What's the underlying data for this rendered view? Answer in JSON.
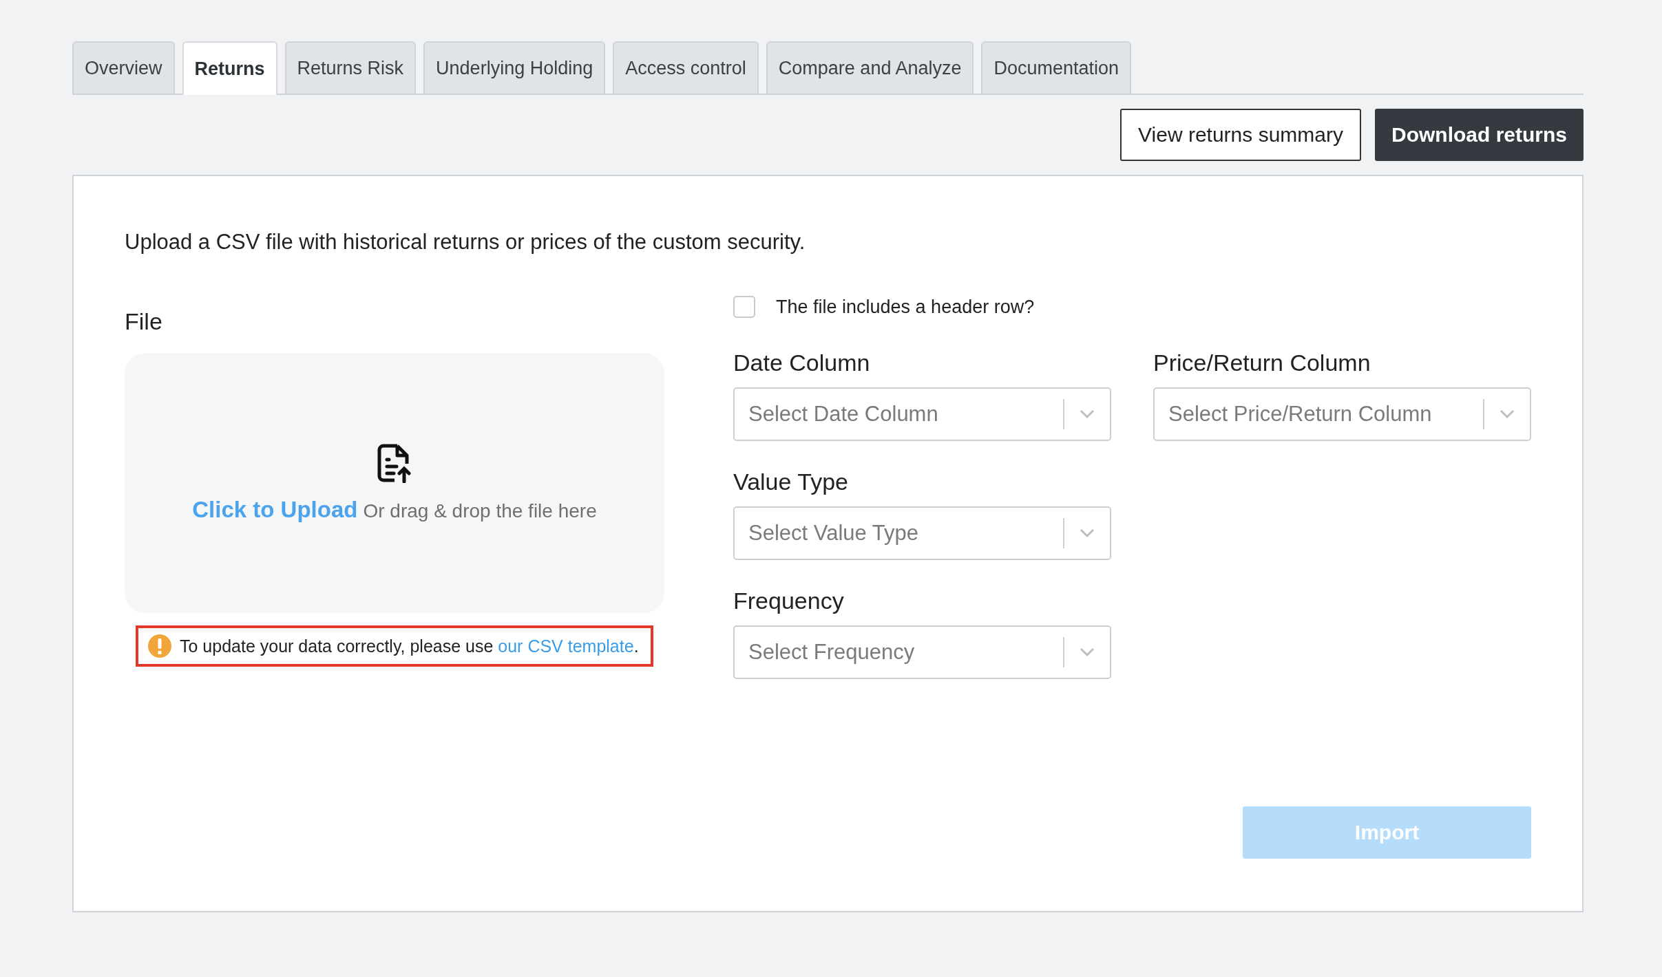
{
  "tabs": [
    {
      "label": "Overview",
      "selected": false
    },
    {
      "label": "Returns",
      "selected": true
    },
    {
      "label": "Returns Risk",
      "selected": false
    },
    {
      "label": "Underlying Holding",
      "selected": false
    },
    {
      "label": "Access control",
      "selected": false
    },
    {
      "label": "Compare and Analyze",
      "selected": false
    },
    {
      "label": "Documentation",
      "selected": false
    }
  ],
  "actions": {
    "view_summary": "View returns summary",
    "download": "Download returns"
  },
  "intro": "Upload a CSV file with historical returns or prices of the custom security.",
  "file": {
    "label": "File",
    "upload_link": "Click to Upload",
    "upload_hint": "Or drag & drop the file here",
    "warning": "To update your data correctly, please use ",
    "warning_link": "our CSV template",
    "warning_end": "."
  },
  "header_row": {
    "label": "The file includes a header row?",
    "checked": false
  },
  "fields": [
    {
      "label": "Date Column",
      "placeholder": "Select Date Column"
    },
    {
      "label": "Price/Return Column",
      "placeholder": "Select Price/Return Column"
    },
    {
      "label": "Value Type",
      "placeholder": "Select Value Type"
    },
    {
      "label": "Frequency",
      "placeholder": "Select Frequency"
    }
  ],
  "import_button": {
    "label": "Import",
    "disabled": true
  }
}
